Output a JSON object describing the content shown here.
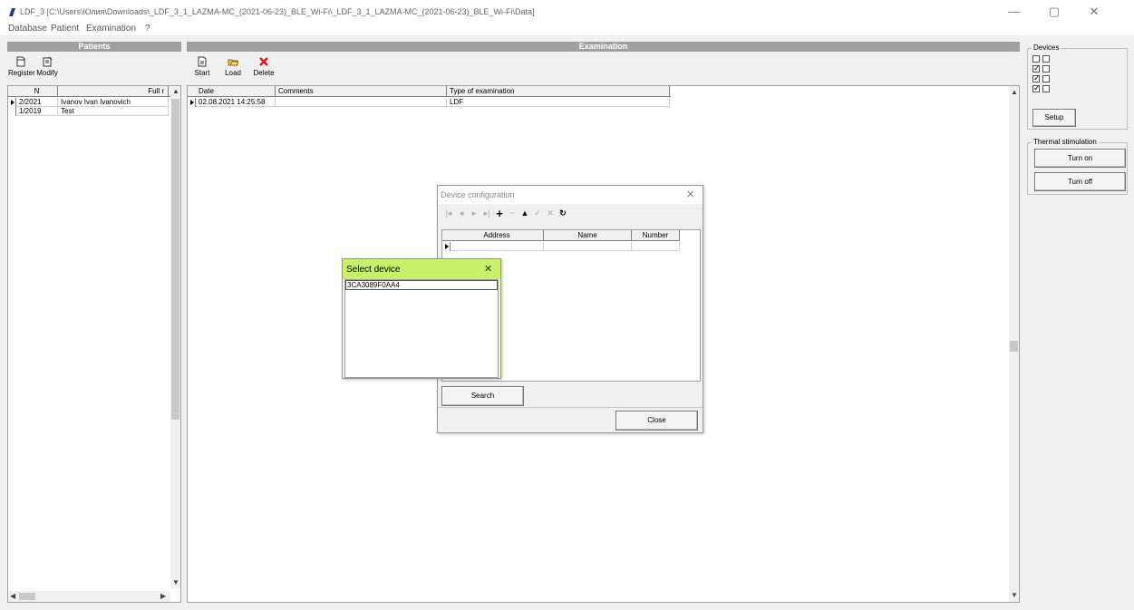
{
  "window": {
    "title": "LDF_3 [C:\\Users\\Юлия\\Downloads\\_LDF_3_1_LAZMA-MC_(2021-06-23)_BLE_Wi-Fi\\_LDF_3_1_LAZMA-MC_(2021-06-23)_BLE_Wi-Fi\\Data]",
    "minimize": "—",
    "maximize": "▢",
    "close": "✕",
    "icon": "app-logo-icon"
  },
  "menu": [
    "Database",
    "Patient",
    "Examination",
    "?"
  ],
  "patients": {
    "header": "Patients",
    "toolbar": [
      {
        "label": "Register",
        "icon": "new-document-icon"
      },
      {
        "label": "Modify",
        "icon": "edit-document-icon"
      }
    ],
    "columns": [
      "N",
      "Full r"
    ],
    "rows": [
      {
        "n": "2/2021",
        "name": "Ivanov Ivan Ivanovich",
        "selected": true
      },
      {
        "n": "1/2019",
        "name": "Test",
        "selected": false
      }
    ]
  },
  "examination": {
    "header": "Examination",
    "toolbar": [
      {
        "label": "Start",
        "icon": "new-document-icon"
      },
      {
        "label": "Load",
        "icon": "folder-open-icon"
      },
      {
        "label": "Delete",
        "icon": "delete-x-icon"
      }
    ],
    "columns": [
      "Date",
      "Comments",
      "Type of examination"
    ],
    "rows": [
      {
        "date": "02.08.2021 14:25:58",
        "comments": "",
        "type": "LDF",
        "selected": true
      }
    ]
  },
  "devices": {
    "title": "Devices",
    "checks": [
      [
        false,
        false
      ],
      [
        true,
        false
      ],
      [
        true,
        false
      ],
      [
        true,
        false
      ]
    ],
    "setup_label": "Setup"
  },
  "thermal": {
    "title": "Thermal stimulation",
    "turn_on": "Turn on",
    "turn_off": "Turn off"
  },
  "device_config": {
    "title": "Device configuration",
    "close_x": "✕",
    "columns": [
      "Address",
      "Name",
      "Number"
    ],
    "search_label": "Search",
    "close_label": "Close"
  },
  "select_device": {
    "title": "Select device",
    "close_x": "✕",
    "items": [
      "3CA3089F0AA4"
    ],
    "title_bg": "#c8f06a"
  }
}
